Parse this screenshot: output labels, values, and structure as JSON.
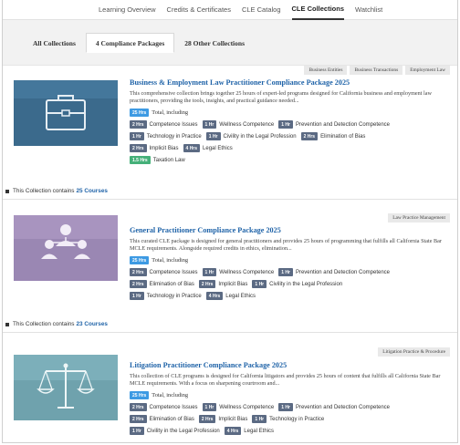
{
  "nav": {
    "items": [
      {
        "label": "Learning Overview",
        "active": false
      },
      {
        "label": "Credits & Certificates",
        "active": false
      },
      {
        "label": "CLE Catalog",
        "active": false
      },
      {
        "label": "CLE Collections",
        "active": true
      },
      {
        "label": "Watchlist",
        "active": false
      }
    ]
  },
  "tabs": [
    {
      "label": "All Collections",
      "active": false
    },
    {
      "label": "4 Compliance Packages",
      "active": true
    },
    {
      "label": "28 Other Collections",
      "active": false
    }
  ],
  "collections": [
    {
      "title": "Business & Employment Law Practitioner Compliance Package 2025",
      "tags": [
        "Business Entities",
        "Business Transactions",
        "Employment Law"
      ],
      "image_icon": "briefcase-icon",
      "image_color": "#3b6a8c",
      "description": "This comprehensive collection brings together 25 hours of expert-led programs designed for California business and employment law practitioners, providing the tools, insights, and practical guidance needed...",
      "total": {
        "hours": "25 Hrs",
        "label": "Total, including"
      },
      "requirement_rows": [
        [
          {
            "hours": "2 Hrs",
            "label": "Competence Issues"
          },
          {
            "hours": "1 Hr",
            "label": "Wellness Competence"
          },
          {
            "hours": "1 Hr",
            "label": "Prevention and Detection Competence"
          }
        ],
        [
          {
            "hours": "1 Hr",
            "label": "Technology in Practice"
          },
          {
            "hours": "1 Hr",
            "label": "Civility in the Legal Profession"
          },
          {
            "hours": "2 Hrs",
            "label": "Elimination of Bias"
          }
        ],
        [
          {
            "hours": "2 Hrs",
            "label": "Implicit Bias"
          },
          {
            "hours": "4 Hrs",
            "label": "Legal Ethics"
          }
        ],
        [
          {
            "hours": "1.5 Hrs",
            "label": "Taxation Law",
            "color": "green"
          }
        ]
      ],
      "contains_prefix": "This Collection contains",
      "courses_link": "25 Courses"
    },
    {
      "title": "General Practitioner Compliance Package 2025",
      "tags": [
        "Law Practice Management"
      ],
      "image_icon": "people-icon",
      "image_color": "#9a87b3",
      "description": "This curated CLE package is designed for general practitioners and provides 25 hours of programming that fulfills all California State Bar MCLE requirements. Alongside required credits in ethics, elimination...",
      "total": {
        "hours": "25 Hrs",
        "label": "Total, including"
      },
      "requirement_rows": [
        [
          {
            "hours": "2 Hrs",
            "label": "Competence Issues"
          },
          {
            "hours": "1 Hr",
            "label": "Wellness Competence"
          },
          {
            "hours": "1 Hr",
            "label": "Prevention and Detection Competence"
          }
        ],
        [
          {
            "hours": "2 Hrs",
            "label": "Elimination of Bias"
          },
          {
            "hours": "2 Hrs",
            "label": "Implicit Bias"
          },
          {
            "hours": "1 Hr",
            "label": "Civility in the Legal Profession"
          }
        ],
        [
          {
            "hours": "1 Hr",
            "label": "Technology in Practice"
          },
          {
            "hours": "4 Hrs",
            "label": "Legal Ethics"
          }
        ]
      ],
      "contains_prefix": "This Collection contains",
      "courses_link": "23 Courses"
    },
    {
      "title": "Litigation Practitioner Compliance Package 2025",
      "tags": [
        "Litigation Practice & Procedure"
      ],
      "image_icon": "scales-icon",
      "image_color": "#6fa2ad",
      "description": "This collection of CLE programs is designed for California litigators and provides 25 hours of content that fulfills all California State Bar MCLE requirements. With a focus on sharpening courtroom and...",
      "total": {
        "hours": "25 Hrs",
        "label": "Total, including"
      },
      "requirement_rows": [
        [
          {
            "hours": "2 Hrs",
            "label": "Competence Issues"
          },
          {
            "hours": "1 Hr",
            "label": "Wellness Competence"
          },
          {
            "hours": "1 Hr",
            "label": "Prevention and Detection Competence"
          }
        ],
        [
          {
            "hours": "2 Hrs",
            "label": "Elimination of Bias"
          },
          {
            "hours": "2 Hrs",
            "label": "Implicit Bias"
          },
          {
            "hours": "1 Hr",
            "label": "Technology in Practice"
          }
        ],
        [
          {
            "hours": "1 Hr",
            "label": "Civility in the Legal Profession"
          },
          {
            "hours": "4 Hrs",
            "label": "Legal Ethics"
          }
        ]
      ]
    }
  ]
}
